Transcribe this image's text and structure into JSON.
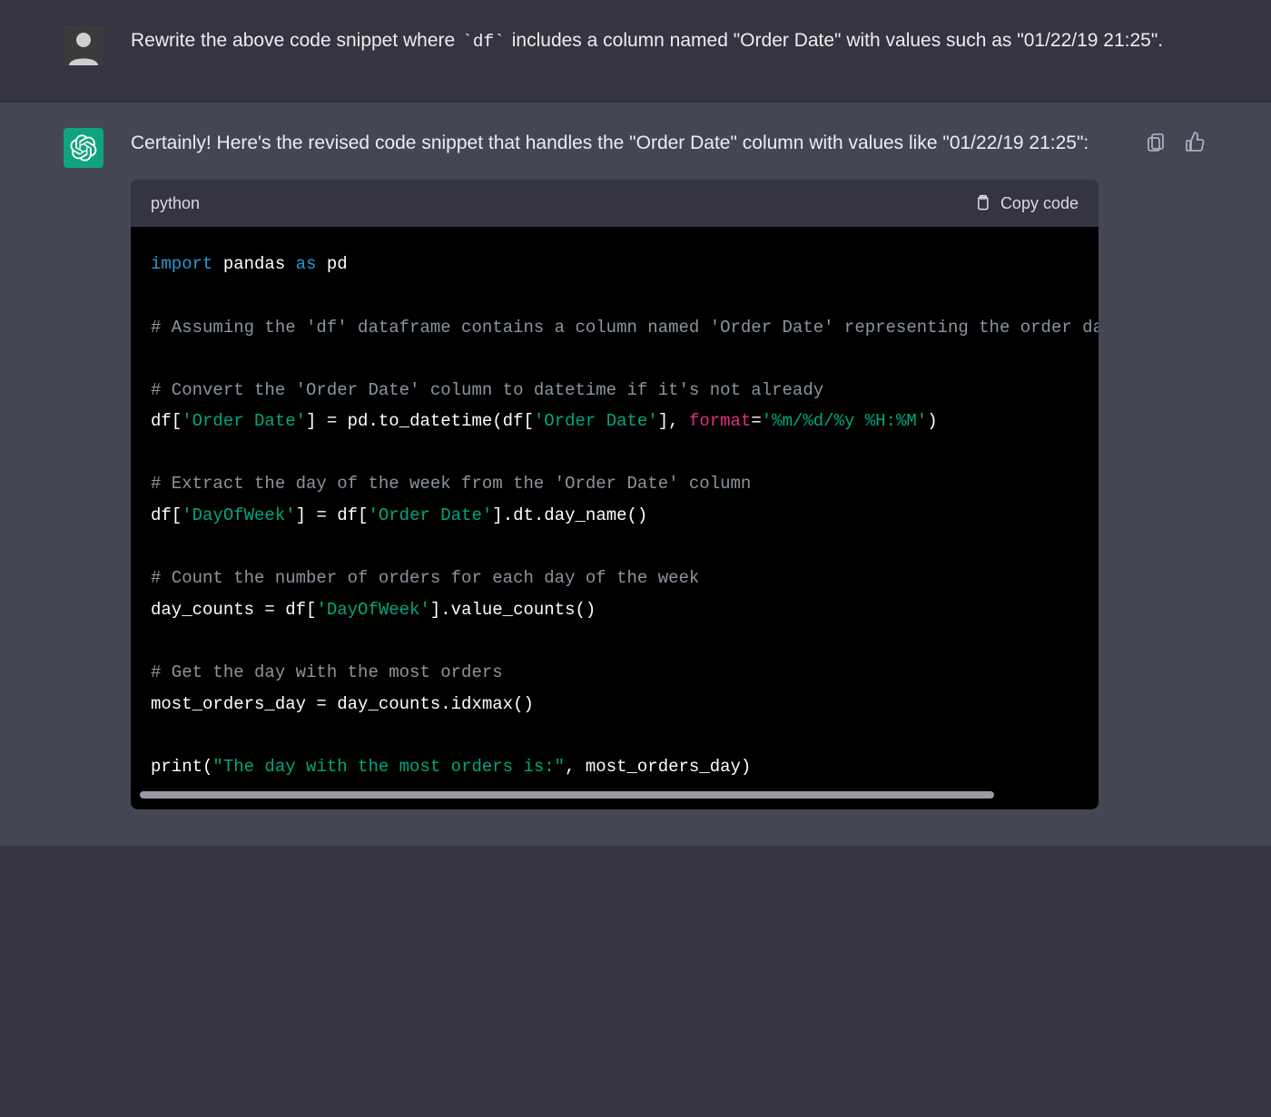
{
  "user_message": {
    "text_before_code": "Rewrite the above code snippet where ",
    "code_token": "`df`",
    "text_after_code": " includes a column named \"Order Date\" with values such as \"01/22/19 21:25\"."
  },
  "assistant_message": {
    "intro": "Certainly! Here's the revised code snippet that handles the \"Order Date\" column with values like \"01/22/19 21:25\":"
  },
  "code_block": {
    "language": "python",
    "copy_label": "Copy code",
    "lines": [
      {
        "segments": [
          {
            "cls": "tok-kw",
            "t": "import"
          },
          {
            "cls": "tok-plain",
            "t": " pandas "
          },
          {
            "cls": "tok-kw",
            "t": "as"
          },
          {
            "cls": "tok-plain",
            "t": " pd"
          }
        ]
      },
      {
        "segments": []
      },
      {
        "segments": [
          {
            "cls": "tok-cmt",
            "t": "# Assuming the 'df' dataframe contains a column named 'Order Date' representing the order dates"
          }
        ]
      },
      {
        "segments": []
      },
      {
        "segments": [
          {
            "cls": "tok-cmt",
            "t": "# Convert the 'Order Date' column to datetime if it's not already"
          }
        ]
      },
      {
        "segments": [
          {
            "cls": "tok-plain",
            "t": "df["
          },
          {
            "cls": "tok-str",
            "t": "'Order Date'"
          },
          {
            "cls": "tok-plain",
            "t": "] = pd.to_datetime(df["
          },
          {
            "cls": "tok-str",
            "t": "'Order Date'"
          },
          {
            "cls": "tok-plain",
            "t": "], "
          },
          {
            "cls": "tok-fmt",
            "t": "format"
          },
          {
            "cls": "tok-plain",
            "t": "="
          },
          {
            "cls": "tok-str",
            "t": "'%m/%d/%y %H:%M'"
          },
          {
            "cls": "tok-plain",
            "t": ")"
          }
        ]
      },
      {
        "segments": []
      },
      {
        "segments": [
          {
            "cls": "tok-cmt",
            "t": "# Extract the day of the week from the 'Order Date' column"
          }
        ]
      },
      {
        "segments": [
          {
            "cls": "tok-plain",
            "t": "df["
          },
          {
            "cls": "tok-str",
            "t": "'DayOfWeek'"
          },
          {
            "cls": "tok-plain",
            "t": "] = df["
          },
          {
            "cls": "tok-str",
            "t": "'Order Date'"
          },
          {
            "cls": "tok-plain",
            "t": "].dt.day_name()"
          }
        ]
      },
      {
        "segments": []
      },
      {
        "segments": [
          {
            "cls": "tok-cmt",
            "t": "# Count the number of orders for each day of the week"
          }
        ]
      },
      {
        "segments": [
          {
            "cls": "tok-plain",
            "t": "day_counts = df["
          },
          {
            "cls": "tok-str",
            "t": "'DayOfWeek'"
          },
          {
            "cls": "tok-plain",
            "t": "].value_counts()"
          }
        ]
      },
      {
        "segments": []
      },
      {
        "segments": [
          {
            "cls": "tok-cmt",
            "t": "# Get the day with the most orders"
          }
        ]
      },
      {
        "segments": [
          {
            "cls": "tok-plain",
            "t": "most_orders_day = day_counts.idxmax()"
          }
        ]
      },
      {
        "segments": []
      },
      {
        "segments": [
          {
            "cls": "tok-plain",
            "t": "print("
          },
          {
            "cls": "tok-str",
            "t": "\"The day with the most orders is:\""
          },
          {
            "cls": "tok-plain",
            "t": ", most_orders_day)"
          }
        ]
      }
    ]
  },
  "icons": {
    "clipboard": "clipboard-icon",
    "thumbs_up": "thumbs-up-icon"
  }
}
